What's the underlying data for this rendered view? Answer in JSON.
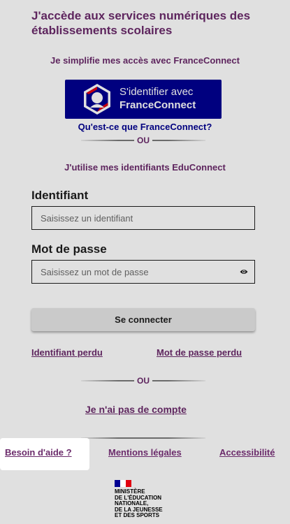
{
  "title": "J'accède aux services numériques des établissements scolaires",
  "franceconnect": {
    "heading": "Je simplifie mes accès avec FranceConnect",
    "button_line1": "S'identifier avec",
    "button_line2": "FranceConnect",
    "help_link": "Qu'est-ce que FranceConnect?"
  },
  "separator_label": "OU",
  "educonnect": {
    "heading": "J'utilise mes identifiants EduConnect",
    "identifiant_label": "Identifiant",
    "identifiant_placeholder": "Saisissez un identifiant",
    "password_label": "Mot de passe",
    "password_placeholder": "Saisissez un mot de passe",
    "login_button": "Se connecter",
    "lost_id_link": "Identifiant perdu",
    "lost_password_link": "Mot de passe perdu"
  },
  "no_account_link": "Je n'ai pas de compte",
  "footer": {
    "help_link": "Besoin d'aide ?",
    "legal_link": "Mentions légales",
    "accessibility_link": "Accessibilité",
    "ministry_lines": [
      "MINISTÈRE",
      "DE L'ÉDUCATION",
      "NATIONALE,",
      "DE LA JEUNESSE",
      "ET DES SPORTS"
    ]
  },
  "colors": {
    "accent": "#6b2b6b",
    "franceconnect_blue": "#000091"
  }
}
